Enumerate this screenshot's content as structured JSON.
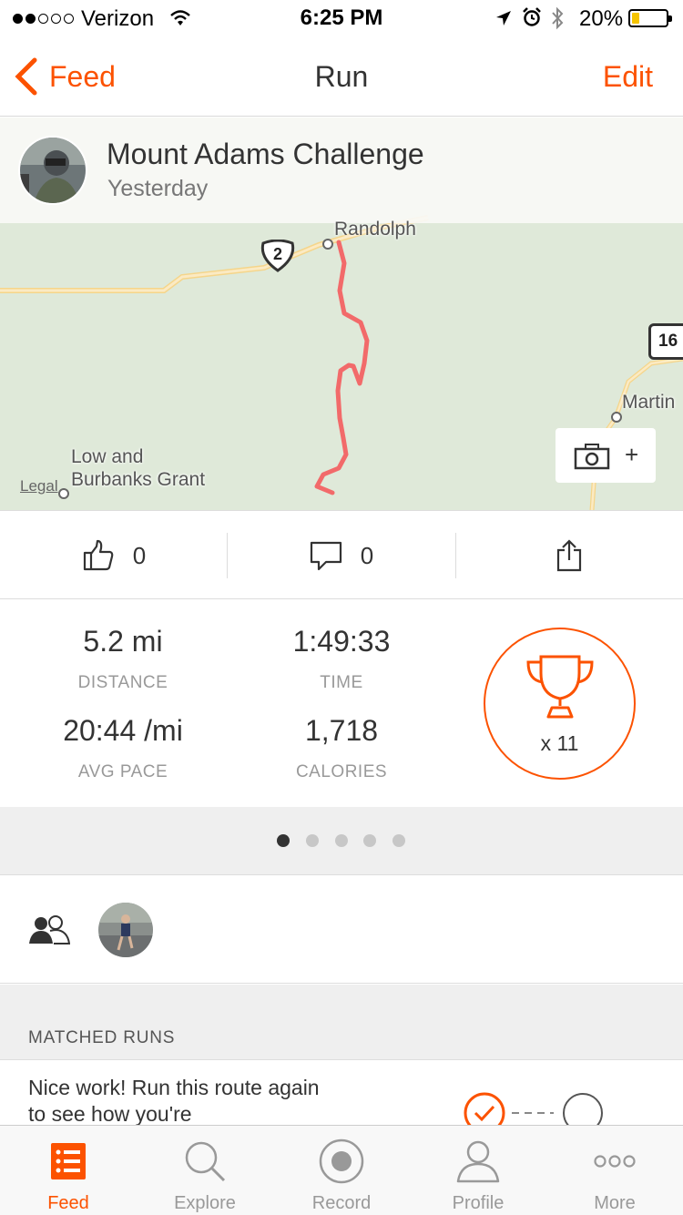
{
  "status_bar": {
    "carrier": "Verizon",
    "time": "6:25 PM",
    "battery": "20%",
    "signal_dots_filled": 2,
    "signal_dots_total": 5
  },
  "nav": {
    "back_label": "Feed",
    "title": "Run",
    "edit_label": "Edit"
  },
  "activity": {
    "name": "Mount Adams Challenge",
    "date": "Yesterday"
  },
  "map": {
    "places": [
      "Randolph",
      "Martin",
      "Low and",
      "Burbanks Grant"
    ],
    "route_shield_2": "2",
    "route_shield_16": "16",
    "legal": "Legal",
    "camera_add": "+"
  },
  "social": {
    "kudos_count": "0",
    "comment_count": "0"
  },
  "stats": {
    "distance": {
      "value": "5.2 mi",
      "label": "DISTANCE"
    },
    "time": {
      "value": "1:49:33",
      "label": "TIME"
    },
    "pace": {
      "value": "20:44 /mi",
      "label": "AVG PACE"
    },
    "calories": {
      "value": "1,718",
      "label": "CALORIES"
    },
    "achievements": "x 11"
  },
  "pager": {
    "pages": 5,
    "active_index": 0
  },
  "matched_runs": {
    "header": "MATCHED RUNS",
    "message": "Nice work! Run this route again to see how you're"
  },
  "tabs": [
    {
      "label": "Feed",
      "icon": "feed-icon"
    },
    {
      "label": "Explore",
      "icon": "search-icon"
    },
    {
      "label": "Record",
      "icon": "record-icon"
    },
    {
      "label": "Profile",
      "icon": "profile-icon"
    },
    {
      "label": "More",
      "icon": "more-icon"
    }
  ],
  "colors": {
    "accent": "#fc5200",
    "route": "#f26a6a",
    "map_land": "#dfe9d9",
    "road": "#f5d58a"
  }
}
